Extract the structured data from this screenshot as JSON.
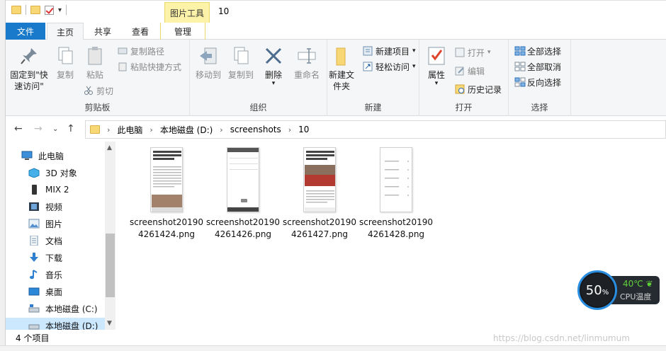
{
  "window": {
    "title": "10",
    "context_tab_header": "图片工具"
  },
  "tabs": {
    "file": "文件",
    "home": "主页",
    "share": "共享",
    "view": "查看",
    "manage": "管理"
  },
  "ribbon": {
    "clipboard": {
      "label": "剪贴板",
      "pin_quick_access": "固定到\"快速访问\"",
      "copy": "复制",
      "paste": "粘贴",
      "copy_path": "复制路径",
      "paste_shortcut": "粘贴快捷方式",
      "cut": "剪切"
    },
    "organize": {
      "label": "组织",
      "move_to": "移动到",
      "copy_to": "复制到",
      "delete": "删除",
      "rename": "重命名"
    },
    "new": {
      "label": "新建",
      "new_folder": "新建文件夹",
      "new_item": "新建项目",
      "easy_access": "轻松访问"
    },
    "open": {
      "label": "打开",
      "properties": "属性",
      "open": "打开",
      "edit": "编辑",
      "history": "历史记录"
    },
    "select": {
      "label": "选择",
      "select_all": "全部选择",
      "select_none": "全部取消",
      "invert": "反向选择"
    }
  },
  "address": {
    "crumbs": [
      "此电脑",
      "本地磁盘 (D:)",
      "screenshots",
      "10"
    ]
  },
  "nav_pane": {
    "items": [
      {
        "label": "此电脑",
        "icon": "pc-icon"
      },
      {
        "label": "3D 对象",
        "icon": "cube-3d-icon"
      },
      {
        "label": "MIX 2",
        "icon": "phone-icon"
      },
      {
        "label": "视频",
        "icon": "video-icon"
      },
      {
        "label": "图片",
        "icon": "picture-icon"
      },
      {
        "label": "文档",
        "icon": "document-icon"
      },
      {
        "label": "下载",
        "icon": "download-icon"
      },
      {
        "label": "音乐",
        "icon": "music-icon"
      },
      {
        "label": "桌面",
        "icon": "desktop-icon"
      },
      {
        "label": "本地磁盘 (C:)",
        "icon": "drive-c-icon"
      },
      {
        "label": "本地磁盘 (D:)",
        "icon": "drive-d-icon"
      }
    ]
  },
  "files": [
    {
      "name": "screenshot201904261424.png"
    },
    {
      "name": "screenshot201904261426.png"
    },
    {
      "name": "screenshot201904261427.png"
    },
    {
      "name": "screenshot201904261428.png"
    }
  ],
  "status": {
    "count": "4 个项目"
  },
  "cpu_widget": {
    "percent": "50",
    "percent_unit": "%",
    "temp": "40℃",
    "label": "CPU温度"
  },
  "watermark": "https://blog.csdn.net/linmumum"
}
